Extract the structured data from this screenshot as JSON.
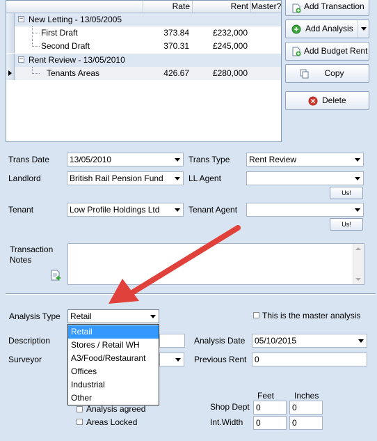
{
  "grid": {
    "columns": {
      "rate": "Rate",
      "rent": "Rent",
      "master": "Master?"
    },
    "groups": [
      {
        "label": "New Letting - 13/05/2005",
        "rows": [
          {
            "name": "First Draft",
            "rate": "373.84",
            "rent": "£232,000"
          },
          {
            "name": "Second Draft",
            "rate": "370.31",
            "rent": "£245,000"
          }
        ]
      },
      {
        "label": "Rent Review - 13/05/2010",
        "rows": [
          {
            "name": "Tenants Areas",
            "rate": "426.67",
            "rent": "£280,000"
          }
        ]
      }
    ]
  },
  "actions": {
    "add_transaction": "Add Transaction",
    "add_analysis": "Add Analysis",
    "add_budget_rent": "Add Budget Rent",
    "copy": "Copy",
    "delete": "Delete"
  },
  "form": {
    "trans_date": {
      "label": "Trans Date",
      "value": "13/05/2010"
    },
    "trans_type": {
      "label": "Trans Type",
      "value": "Rent Review"
    },
    "landlord": {
      "label": "Landlord",
      "value": "British Rail Pension Fund"
    },
    "ll_agent": {
      "label": "LL Agent",
      "value": ""
    },
    "tenant": {
      "label": "Tenant",
      "value": "Low Profile Holdings Ltd"
    },
    "tenant_agent": {
      "label": "Tenant Agent",
      "value": ""
    },
    "us_button": "Us!",
    "transaction_notes": {
      "label_line1": "Transaction",
      "label_line2": "Notes",
      "value": ""
    },
    "analysis_type": {
      "label": "Analysis Type",
      "value": "Retail"
    },
    "master_analysis": {
      "label": "This is the master analysis",
      "checked": false
    },
    "description": {
      "label": "Description",
      "value": ""
    },
    "surveyor": {
      "label": "Surveyor",
      "value": ""
    },
    "analysis_date": {
      "label": "Analysis Date",
      "value": "05/10/2015"
    },
    "previous_rent": {
      "label": "Previous Rent",
      "value": "0"
    },
    "analysis_agreed": {
      "label": "Analysis agreed",
      "checked": false
    },
    "areas_locked": {
      "label": "Areas Locked",
      "checked": false
    },
    "dimensions": {
      "feet_header": "Feet",
      "inches_header": "Inches",
      "shop_dept": {
        "label": "Shop Dept",
        "feet": "0",
        "inches": "0"
      },
      "int_width": {
        "label": "Int.Width",
        "feet": "0",
        "inches": "0"
      }
    }
  },
  "analysis_type_options": [
    "Retail",
    "Stores / Retail WH",
    "A3/Food/Restaurant",
    "Offices",
    "Industrial",
    "Other"
  ],
  "colors": {
    "background": "#d9e4f2",
    "selection": "#3399ff",
    "annotation_arrow": "#e0413a",
    "add_green": "#3aa63a",
    "delete_red": "#d23b2e"
  }
}
